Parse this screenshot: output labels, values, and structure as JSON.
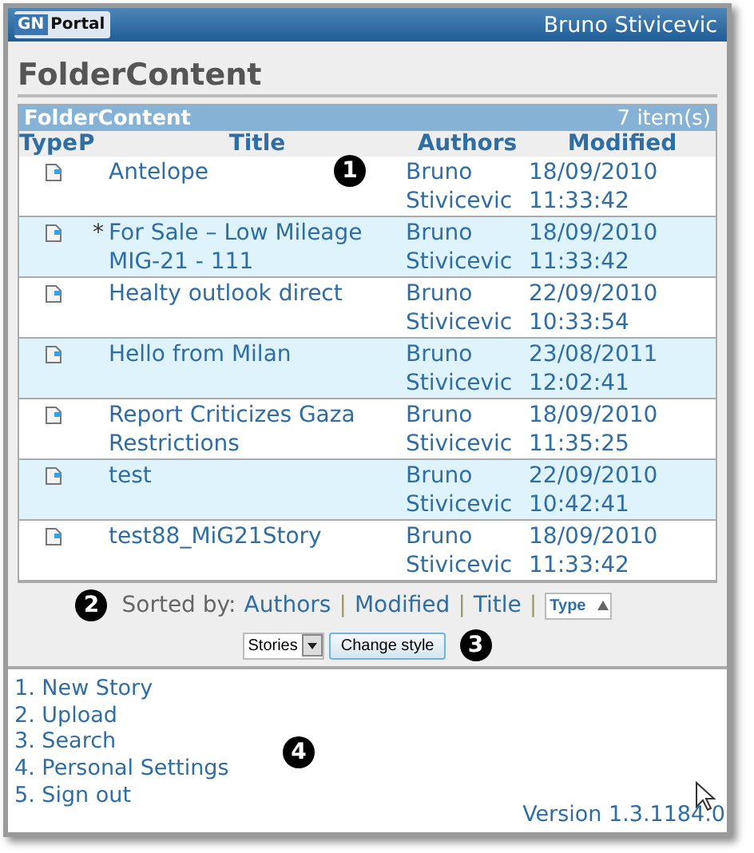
{
  "header": {
    "logo_badge": "GN",
    "logo_text": "Portal",
    "user": "Bruno Stivicevic"
  },
  "page_title": "FolderContent",
  "panel": {
    "title": "FolderContent",
    "count": "7 item(s)",
    "columns": [
      "Type",
      "P",
      "Title",
      "Authors",
      "Modified"
    ],
    "rows": [
      {
        "p": "",
        "title": "Antelope",
        "author": "Bruno Stivicevic",
        "date": "18/09/2010",
        "time": "11:33:42"
      },
      {
        "p": "*",
        "title": "For Sale – Low Mileage MIG-21 - 111",
        "author": "Bruno Stivicevic",
        "date": "18/09/2010",
        "time": "11:33:42"
      },
      {
        "p": "",
        "title": "Healty outlook direct",
        "author": "Bruno Stivicevic",
        "date": "22/09/2010",
        "time": "10:33:54"
      },
      {
        "p": "",
        "title": "Hello from Milan",
        "author": "Bruno Stivicevic",
        "date": "23/08/2011",
        "time": "12:02:41"
      },
      {
        "p": "",
        "title": "Report Criticizes Gaza Restrictions",
        "author": "Bruno Stivicevic",
        "date": "18/09/2010",
        "time": "11:35:25"
      },
      {
        "p": "",
        "title": "test",
        "author": "Bruno Stivicevic",
        "date": "22/09/2010",
        "time": "10:42:41"
      },
      {
        "p": "",
        "title": "test88_MiG21Story",
        "author": "Bruno Stivicevic",
        "date": "18/09/2010",
        "time": "11:33:42"
      }
    ]
  },
  "sort": {
    "label": "Sorted by:",
    "separator": "|",
    "options": [
      {
        "label": "Authors",
        "selected": false
      },
      {
        "label": "Modified",
        "selected": false
      },
      {
        "label": "Title",
        "selected": false
      },
      {
        "label": "Type",
        "selected": true
      }
    ]
  },
  "style_select": {
    "value": "Stories"
  },
  "style_button": "Change style",
  "callouts": [
    "1",
    "2",
    "3",
    "4"
  ],
  "menu": [
    "1. New Story",
    "2. Upload",
    "3. Search",
    "4. Personal Settings",
    "5. Sign out"
  ],
  "version": "Version 1.3.1184.0"
}
